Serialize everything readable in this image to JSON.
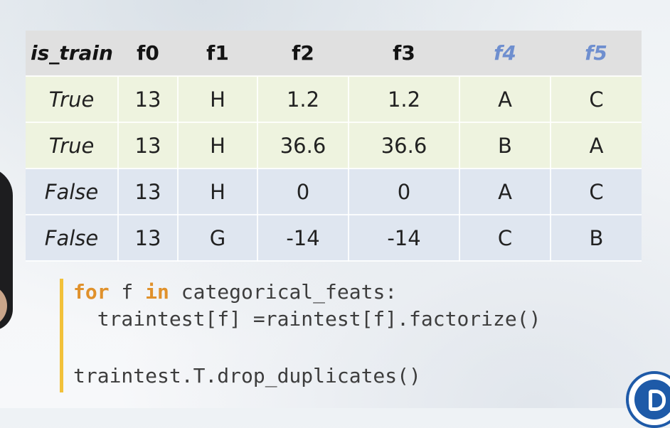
{
  "table": {
    "headers": [
      "is_train",
      "f0",
      "f1",
      "f2",
      "f3",
      "f4",
      "f5"
    ],
    "rows": [
      [
        "True",
        "13",
        "H",
        "1.2",
        "1.2",
        "A",
        "C"
      ],
      [
        "True",
        "13",
        "H",
        "36.6",
        "36.6",
        "B",
        "A"
      ],
      [
        "False",
        "13",
        "H",
        "0",
        "0",
        "A",
        "C"
      ],
      [
        "False",
        "13",
        "G",
        "-14",
        "-14",
        "C",
        "B"
      ]
    ]
  },
  "code": {
    "line1_kw1": "for",
    "line1_mid": " f ",
    "line1_kw2": "in",
    "line1_rest": " categorical_feats:",
    "line2": "  traintest[f] =raintest[f].factorize()",
    "line3": "traintest.T.drop_duplicates()"
  },
  "colors": {
    "accent_header": "#6f8fcf",
    "accent_cell": "#7aa3d8",
    "train_row_bg": "#eef3df",
    "test_row_bg": "#dfe6f0",
    "keyword": "#e0912b",
    "code_bar": "#f2c13a",
    "logo_blue": "#1e5aa8"
  },
  "icons": {
    "logo": "university-logo-icon"
  }
}
